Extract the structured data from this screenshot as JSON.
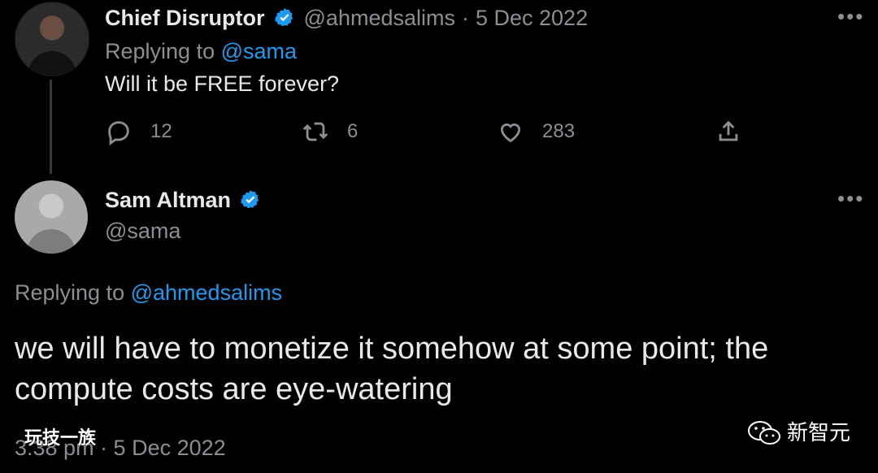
{
  "tweet_top": {
    "name": "Chief Disruptor",
    "handle": "@ahmedsalims",
    "separator": "·",
    "date": "5 Dec 2022",
    "replying_prefix": "Replying to",
    "replying_user": "@sama",
    "text": "Will it be FREE forever?",
    "actions": {
      "replies": "12",
      "retweets": "6",
      "likes": "283"
    },
    "more": "•••"
  },
  "tweet_bottom": {
    "name": "Sam Altman",
    "handle": "@sama",
    "replying_prefix": "Replying to",
    "replying_user": "@ahmedsalims",
    "text": "we will have to monetize it somehow at some point; the compute costs are eye-watering",
    "timestamp": "3:38 pm · 5 Dec 2022",
    "more": "•••"
  },
  "watermarks": {
    "left": "玩技一族",
    "right": "新智元"
  },
  "colors": {
    "background": "#000000",
    "text": "#e7e9ea",
    "muted": "#8b8f93",
    "link": "#1d9bf0",
    "verified": "#1d9bf0"
  },
  "icons": [
    "verified-badge-icon",
    "more-icon",
    "reply-icon",
    "retweet-icon",
    "like-icon",
    "share-icon",
    "wechat-icon"
  ]
}
